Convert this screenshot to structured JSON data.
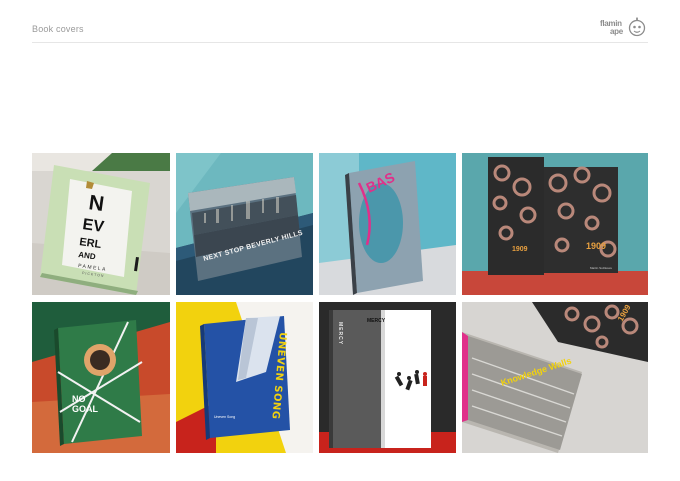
{
  "header": {
    "title": "Book covers",
    "logo_line1": "flamin",
    "logo_line2": "ape"
  },
  "covers": [
    {
      "name": "Neverland",
      "title_lines": [
        "N",
        "EV",
        "ERL",
        "AND"
      ],
      "author": "PAMELA",
      "author_sub": "PICKTON"
    },
    {
      "name": "Next Stop Beverly Hills",
      "title": "NEXT STOP BEVERLY HILLS"
    },
    {
      "name": "Bas",
      "title": "BAS"
    },
    {
      "name": "1909",
      "title": "1909",
      "spine_title": "1909",
      "author": "Martin Sulzkowe"
    },
    {
      "name": "No Goal",
      "title_line1": "NO",
      "title_line2": "GOAL"
    },
    {
      "name": "Uneven Song",
      "title": "UNEVEN SONG",
      "blurb": "Uneven Song"
    },
    {
      "name": "Mercy",
      "title": "MERCY",
      "spine_title": "MERCY"
    },
    {
      "name": "Knowledge Wall",
      "title": "Knowledge Walls",
      "title2": "1909"
    }
  ],
  "colors": {
    "header_rule": "#e6e6e6",
    "title_text": "#9a9a9a",
    "accent_orange": "#e8a040",
    "accent_magenta": "#e0308a",
    "accent_yellow": "#f2d20e",
    "accent_red": "#c8231c"
  }
}
